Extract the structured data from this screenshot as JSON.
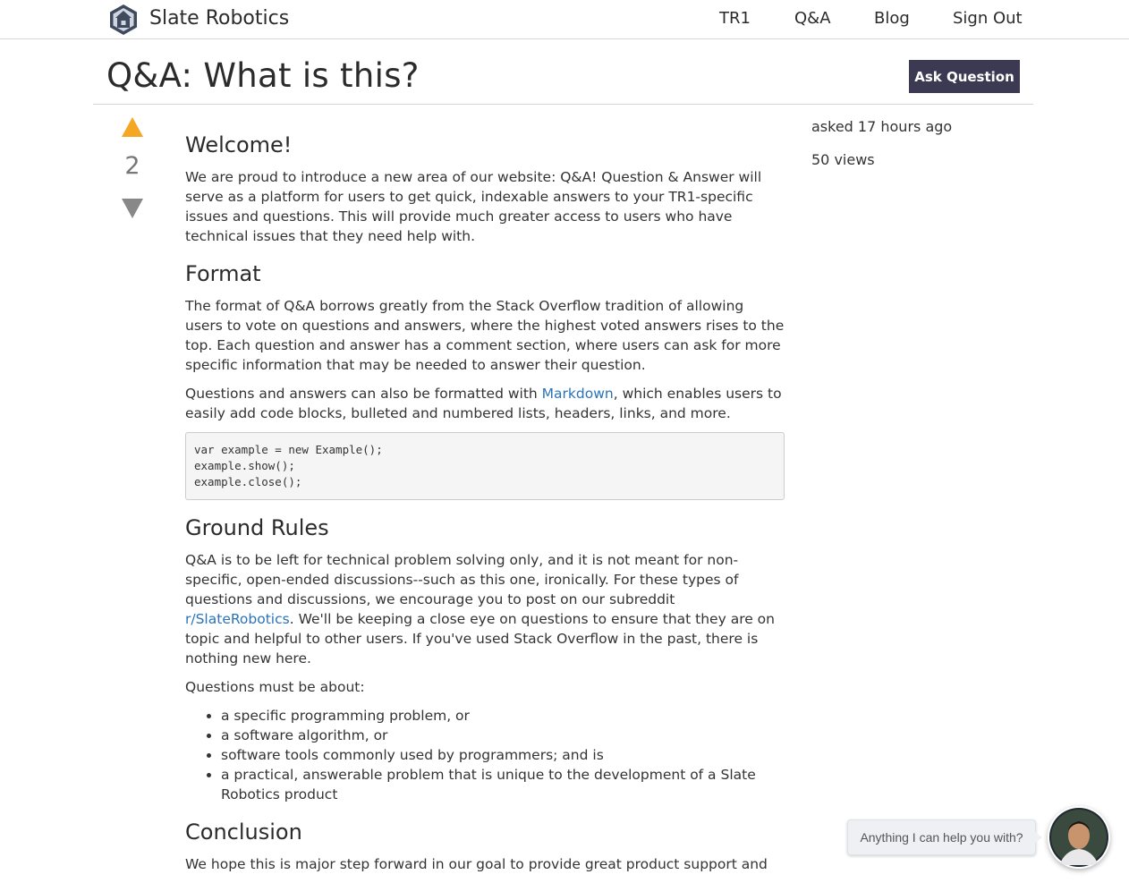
{
  "brand": {
    "name": "Slate Robotics"
  },
  "nav": {
    "tr1": "TR1",
    "qa": "Q&A",
    "blog": "Blog",
    "sign_out": "Sign Out"
  },
  "header": {
    "title": "Q&A: What is this?",
    "ask_button": "Ask Question"
  },
  "vote": {
    "count": "2"
  },
  "meta": {
    "asked": "asked 17 hours ago",
    "views": "50 views"
  },
  "post": {
    "welcome": {
      "heading": "Welcome!",
      "body": "We are proud to introduce a new area of our website: Q&A! Question & Answer will serve as a platform for users to get quick, indexable answers to your TR1-specific issues and questions. This will provide much greater access to users who have technical issues that they need help with."
    },
    "format": {
      "heading": "Format",
      "p1": "The format of Q&A borrows greatly from the Stack Overflow tradition of allowing users to vote on questions and answers, where the highest voted answers rises to the top. Each question and answer has a comment section, where users can ask for more specific information that may be needed to answer their question.",
      "p2_before": "Questions and answers can also be formatted with ",
      "p2_link": "Markdown",
      "p2_after": ", which enables users to easily add code blocks, bulleted and numbered lists, headers, links, and more.",
      "code": [
        "var example = new Example();",
        "example.show();",
        "example.close();"
      ]
    },
    "ground_rules": {
      "heading": "Ground Rules",
      "p1_before": "Q&A is to be left for technical problem solving only, and it is not meant for non-specific, open-ended discussions--such as this one, ironically. For these types of questions and discussions, we encourage you to post on our subreddit ",
      "p1_link": "r/SlateRobotics",
      "p1_after": ". We'll be keeping a close eye on questions to ensure that they are on topic and helpful to other users. If you've used Stack Overflow in the past, there is nothing new here.",
      "p2": "Questions must be about:",
      "items": [
        "a specific programming problem, or",
        "a software algorithm, or",
        "software tools commonly used by programmers; and is",
        "a practical, answerable problem that is unique to the development of a Slate Robotics product"
      ]
    },
    "conclusion": {
      "heading": "Conclusion",
      "body": "We hope this is major step forward in our goal to provide great product support and"
    }
  },
  "chat": {
    "prompt": "Anything I can help you with?"
  },
  "colors": {
    "primary_button": "#3c3a52",
    "vote_up": "#f5a623",
    "vote_down": "#888888",
    "link": "#2a73b8"
  },
  "icons": {
    "logo": "house-icon",
    "vote_up": "triangle-up-icon",
    "vote_down": "triangle-down-icon",
    "chat_avatar": "avatar-icon"
  }
}
